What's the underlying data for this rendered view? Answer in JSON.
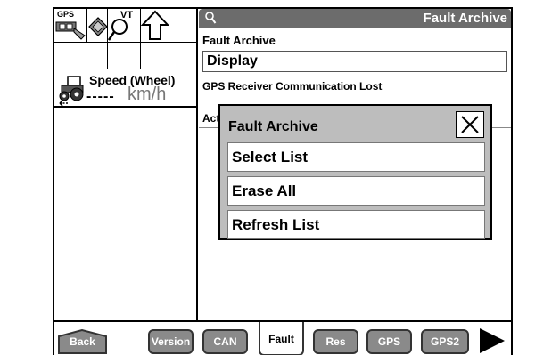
{
  "left": {
    "gps_label": "GPS",
    "vt_label": "VT",
    "speed": {
      "title": "Speed (Wheel)",
      "value": "-----",
      "unit": "km/h"
    }
  },
  "header": {
    "title": "Fault Archive",
    "icon": "magnifier-icon"
  },
  "main": {
    "archive_label": "Fault Archive",
    "display_value": "Display",
    "fault_entry": "GPS Receiver Communication Lost",
    "act_label": "Act"
  },
  "modal": {
    "title": "Fault Archive",
    "buttons": [
      "Select List",
      "Erase All",
      "Refresh List"
    ]
  },
  "bottombar": {
    "back": "Back",
    "tabs": [
      "Version",
      "CAN",
      "Fault",
      "Res",
      "GPS",
      "GPS2"
    ],
    "active_tab": "Fault"
  },
  "colors": {
    "titlebar": "#6c6c6c",
    "tab": "#8a8a8a",
    "modal": "#bdbdbd"
  }
}
